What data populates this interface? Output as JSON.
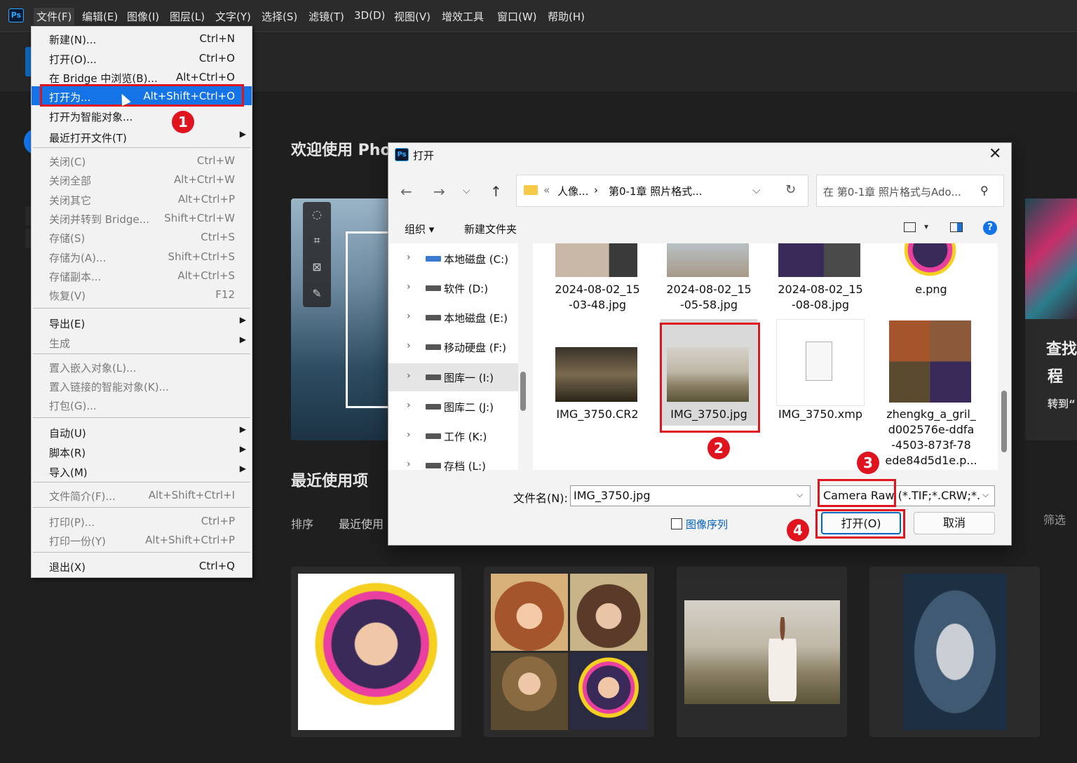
{
  "app": {
    "logo_text": "Ps",
    "menubar": [
      "文件(F)",
      "编辑(E)",
      "图像(I)",
      "图层(L)",
      "文字(Y)",
      "选择(S)",
      "滤镜(T)",
      "3D(D)",
      "视图(V)",
      "增效工具",
      "窗口(W)",
      "帮助(H)"
    ]
  },
  "home": {
    "welcome": "欢迎使用 Pho",
    "recent_title": "最近使用项",
    "sort_label": "排序",
    "sort_value": "最近使用",
    "filter_label": "筛选",
    "right_card": {
      "line1": "查找",
      "line2": "程",
      "line3": "转到“"
    }
  },
  "file_menu": {
    "items": [
      {
        "label": "新建(N)...",
        "shortcut": "Ctrl+N",
        "disabled": false
      },
      {
        "label": "打开(O)...",
        "shortcut": "Ctrl+O",
        "disabled": false
      },
      {
        "label": "在 Bridge 中浏览(B)...",
        "shortcut": "Alt+Ctrl+O",
        "disabled": false
      },
      {
        "label": "打开为...",
        "shortcut": "Alt+Shift+Ctrl+O",
        "disabled": false,
        "highlighted": true
      },
      {
        "label": "打开为智能对象...",
        "shortcut": "",
        "disabled": false
      },
      {
        "label": "最近打开文件(T)",
        "shortcut": "",
        "disabled": false,
        "submenu": true
      },
      {
        "label": "关闭(C)",
        "shortcut": "Ctrl+W",
        "disabled": true
      },
      {
        "label": "关闭全部",
        "shortcut": "Alt+Ctrl+W",
        "disabled": true
      },
      {
        "label": "关闭其它",
        "shortcut": "Alt+Ctrl+P",
        "disabled": true
      },
      {
        "label": "关闭并转到 Bridge...",
        "shortcut": "Shift+Ctrl+W",
        "disabled": true
      },
      {
        "label": "存储(S)",
        "shortcut": "Ctrl+S",
        "disabled": true
      },
      {
        "label": "存储为(A)...",
        "shortcut": "Shift+Ctrl+S",
        "disabled": true
      },
      {
        "label": "存储副本...",
        "shortcut": "Alt+Ctrl+S",
        "disabled": true
      },
      {
        "label": "恢复(V)",
        "shortcut": "F12",
        "disabled": true
      },
      {
        "label": "导出(E)",
        "shortcut": "",
        "disabled": false,
        "submenu": true
      },
      {
        "label": "生成",
        "shortcut": "",
        "disabled": true,
        "submenu": true
      },
      {
        "label": "置入嵌入对象(L)...",
        "shortcut": "",
        "disabled": true
      },
      {
        "label": "置入链接的智能对象(K)...",
        "shortcut": "",
        "disabled": true
      },
      {
        "label": "打包(G)...",
        "shortcut": "",
        "disabled": true
      },
      {
        "label": "自动(U)",
        "shortcut": "",
        "disabled": false,
        "submenu": true
      },
      {
        "label": "脚本(R)",
        "shortcut": "",
        "disabled": false,
        "submenu": true
      },
      {
        "label": "导入(M)",
        "shortcut": "",
        "disabled": false,
        "submenu": true
      },
      {
        "label": "文件简介(F)...",
        "shortcut": "Alt+Shift+Ctrl+I",
        "disabled": true
      },
      {
        "label": "打印(P)...",
        "shortcut": "Ctrl+P",
        "disabled": true
      },
      {
        "label": "打印一份(Y)",
        "shortcut": "Alt+Shift+Ctrl+P",
        "disabled": true
      },
      {
        "label": "退出(X)",
        "shortcut": "Ctrl+Q",
        "disabled": false
      }
    ]
  },
  "annotations": [
    "1",
    "2",
    "3",
    "4"
  ],
  "dialog": {
    "title": "打开",
    "breadcrumb": [
      "«",
      "人像...",
      "›",
      "第0-1章 照片格式..."
    ],
    "search_placeholder": "在 第0-1章 照片格式与Ado...",
    "toolbar": {
      "organize": "组织 ▾",
      "new_folder": "新建文件夹"
    },
    "nav_tree": [
      {
        "name": "本地磁盘 (C:)"
      },
      {
        "name": "软件 (D:)"
      },
      {
        "name": "本地磁盘 (E:)"
      },
      {
        "name": "移动硬盘 (F:)"
      },
      {
        "name": "图库一 (I:)",
        "selected": true
      },
      {
        "name": "图库二 (J:)"
      },
      {
        "name": "工作 (K:)"
      },
      {
        "name": "存档 (L:)"
      }
    ],
    "files": [
      {
        "name_line1": "2024-08-02_15",
        "name_line2": "-03-48.jpg"
      },
      {
        "name_line1": "2024-08-02_15",
        "name_line2": "-05-58.jpg"
      },
      {
        "name_line1": "2024-08-02_15",
        "name_line2": "-08-08.jpg"
      },
      {
        "name_line1": "e.png",
        "name_line2": ""
      },
      {
        "name_line1": "IMG_3750.CR2",
        "name_line2": ""
      },
      {
        "name_line1": "IMG_3750.jpg",
        "name_line2": "",
        "selected": true
      },
      {
        "name_line1": "IMG_3750.xmp",
        "name_line2": ""
      },
      {
        "name_line1": "zhengkg_a_gril_",
        "name_line2": "d002576e-ddfa",
        "name_line3": "-4503-873f-78",
        "name_line4": "ede84d5d1e.p..."
      }
    ],
    "filename_label": "文件名(N):",
    "filename_value": "IMG_3750.jpg",
    "filetype_value": "Camera Raw (*.TIF;*.CRW;*.NEF",
    "image_sequence_label": "图像序列",
    "image_sequence_checked": false,
    "open_button": "打开(O)",
    "cancel_button": "取消"
  },
  "colors": {
    "highlight": "#1473e6",
    "annotation_red": "#e0141e",
    "dialog_bg": "#f3f3f3"
  }
}
